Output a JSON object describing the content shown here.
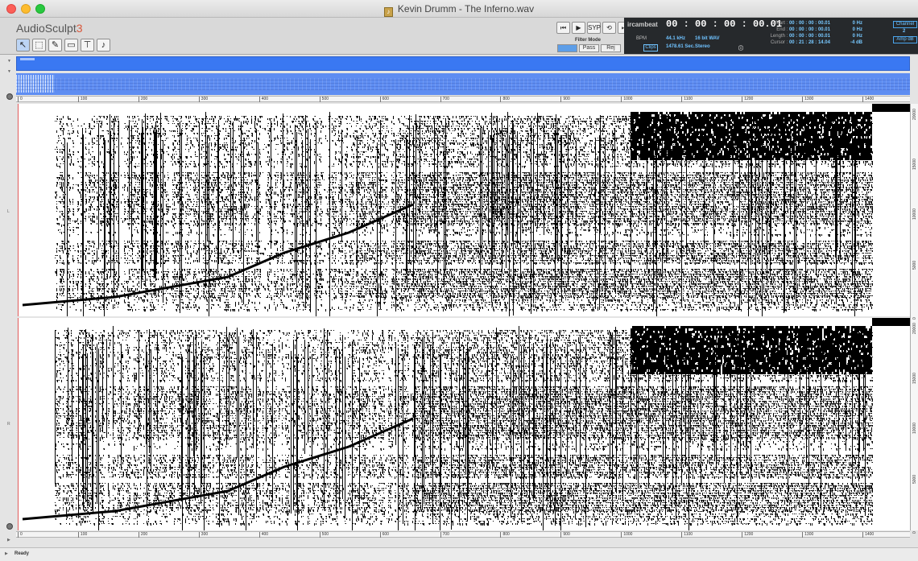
{
  "window": {
    "title": "Kevin Drumm - The Inferno.wav"
  },
  "app": {
    "name": "AudioSculpt",
    "version": "3"
  },
  "tools": [
    {
      "icon": "arrow-select-icon",
      "glyph": "↖"
    },
    {
      "icon": "box-select-icon",
      "glyph": "⬚"
    },
    {
      "icon": "pencil-icon",
      "glyph": "✎"
    },
    {
      "icon": "region-icon",
      "glyph": "▭"
    },
    {
      "icon": "filter-icon",
      "glyph": "⊤"
    },
    {
      "icon": "note-icon",
      "glyph": "♪"
    }
  ],
  "transport": {
    "prev_glyph": "⏮",
    "play_glyph": "▶",
    "sync_label": "SYP",
    "loop_glyph": "⟲",
    "next_glyph": "⏭"
  },
  "filter": {
    "label": "Filter Mode",
    "options": [
      "",
      "Pass",
      "Rej"
    ],
    "selected": 0
  },
  "info": {
    "logo": "ircambeat",
    "timecode": "00 : 00 : 00 : 00.01",
    "bpm_label": "BPM",
    "sample_rate": "44.1 kHz",
    "bit_depth": "16 bit WAV",
    "duration": "1478.61 Sec.",
    "channels_mode": "Stereo",
    "clips_label": "Clips",
    "start_label": "Start :",
    "start_value": "00 : 00 : 00 : 00.01",
    "end_label": "End :",
    "end_value": "00 : 00 : 00 : 00.01",
    "length_label": "Length :",
    "length_value": "00 : 00 : 00 : 00.01",
    "cursor_label": "Cursor :",
    "cursor_value": "00 : 21 : 28 : 14.04",
    "hz1": "0 Hz",
    "hz2": "0 Hz",
    "hz3": "0 Hz",
    "db": "-4 dB",
    "channel_label": "Channel",
    "channel_value": "2",
    "amp_label": "Amp dB"
  },
  "ruler": {
    "ticks": [
      "0",
      "100",
      "200",
      "300",
      "400",
      "500",
      "600",
      "700",
      "800",
      "900",
      "1000",
      "1100",
      "1200",
      "1300",
      "1400"
    ]
  },
  "freq_labels": [
    "20000",
    "15000",
    "10000",
    "5000",
    "0"
  ],
  "left_labels": {
    "top": "L",
    "bottom": "R"
  },
  "status": {
    "text": "Ready"
  }
}
